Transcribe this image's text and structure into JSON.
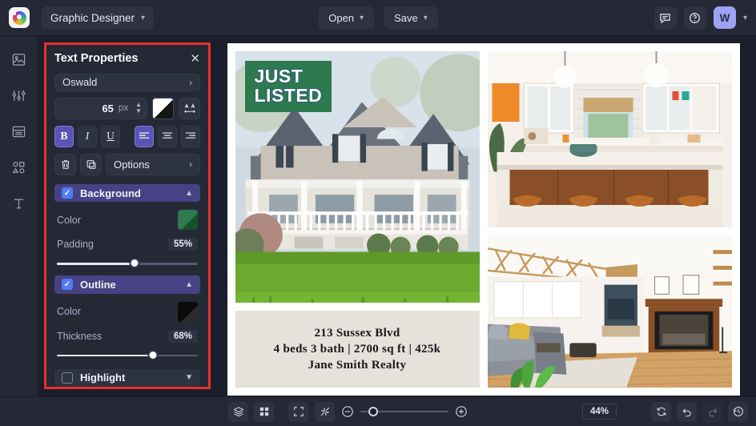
{
  "header": {
    "logo_icon": "color-wheel-logo",
    "project_name": "Graphic Designer",
    "open_label": "Open",
    "save_label": "Save",
    "comment_icon": "comment-icon",
    "help_icon": "help-circle-icon",
    "avatar_initial": "W",
    "caret": "⌄"
  },
  "rail": {
    "items": [
      {
        "icon": "image-icon",
        "name": "images"
      },
      {
        "icon": "sliders-icon",
        "name": "adjustments"
      },
      {
        "icon": "layout-icon",
        "name": "templates"
      },
      {
        "icon": "shapes-icon",
        "name": "elements"
      },
      {
        "icon": "text-icon",
        "name": "text"
      }
    ]
  },
  "panel": {
    "title": "Text Properties",
    "close_icon": "close-icon",
    "font_family": "Oswald",
    "font_size_value": "65",
    "font_size_unit": "px",
    "text_color": "#ffffff",
    "text_color_secondary": "#000000",
    "letter_spacing_icon": "letter-spacing-icon",
    "bold_label": "B",
    "italic_label": "I",
    "underline_label": "U",
    "bold_active": true,
    "align_left_active": true,
    "delete_icon": "trash-icon",
    "duplicate_icon": "duplicate-icon",
    "options_label": "Options",
    "background": {
      "label": "Background",
      "enabled": true,
      "expanded": true,
      "color_label": "Color",
      "color": "#2d7a4f",
      "padding_label": "Padding",
      "padding_value": "55%",
      "padding_pct": 55
    },
    "outline": {
      "label": "Outline",
      "enabled": true,
      "expanded": true,
      "color_label": "Color",
      "color": "#0a0a0a",
      "thickness_label": "Thickness",
      "thickness_value": "68%",
      "thickness_pct": 68
    },
    "highlight": {
      "label": "Highlight",
      "enabled": false,
      "expanded": false
    }
  },
  "canvas": {
    "badge_line1": "JUST",
    "badge_line2": "LISTED",
    "badge_bg": "#2d7a4f",
    "badge_text_color": "#ffffff",
    "badge_outline_color": "#2b4e7e",
    "caption": {
      "address": "213 Sussex Blvd",
      "details": "4 beds 3 bath | 2700 sq ft | 425k",
      "realtor": "Jane Smith Realty",
      "bg": "#e6e1da"
    },
    "photos": [
      {
        "name": "house-exterior-photo",
        "alt": "Large shingled house with white wrap-around porch and green lawn"
      },
      {
        "name": "kitchen-photo",
        "alt": "White kitchen with pendant lights, wood island and leather stools"
      },
      {
        "name": "living-room-photo",
        "alt": "Living room with vaulted beam ceiling, gray sofa and fireplace"
      }
    ]
  },
  "bottom": {
    "layers_icon": "layers-icon",
    "grid_icon": "grid-icon",
    "fit_icon": "fit-screen-icon",
    "collapse_icon": "collapse-icon",
    "zoom_out_icon": "zoom-out-icon",
    "zoom_in_icon": "zoom-in-icon",
    "zoom_level": "44%",
    "zoom_slider_pct": 9,
    "reset_icon": "sync-icon",
    "undo_icon": "undo-icon",
    "redo_icon": "redo-icon",
    "history_icon": "history-icon"
  }
}
